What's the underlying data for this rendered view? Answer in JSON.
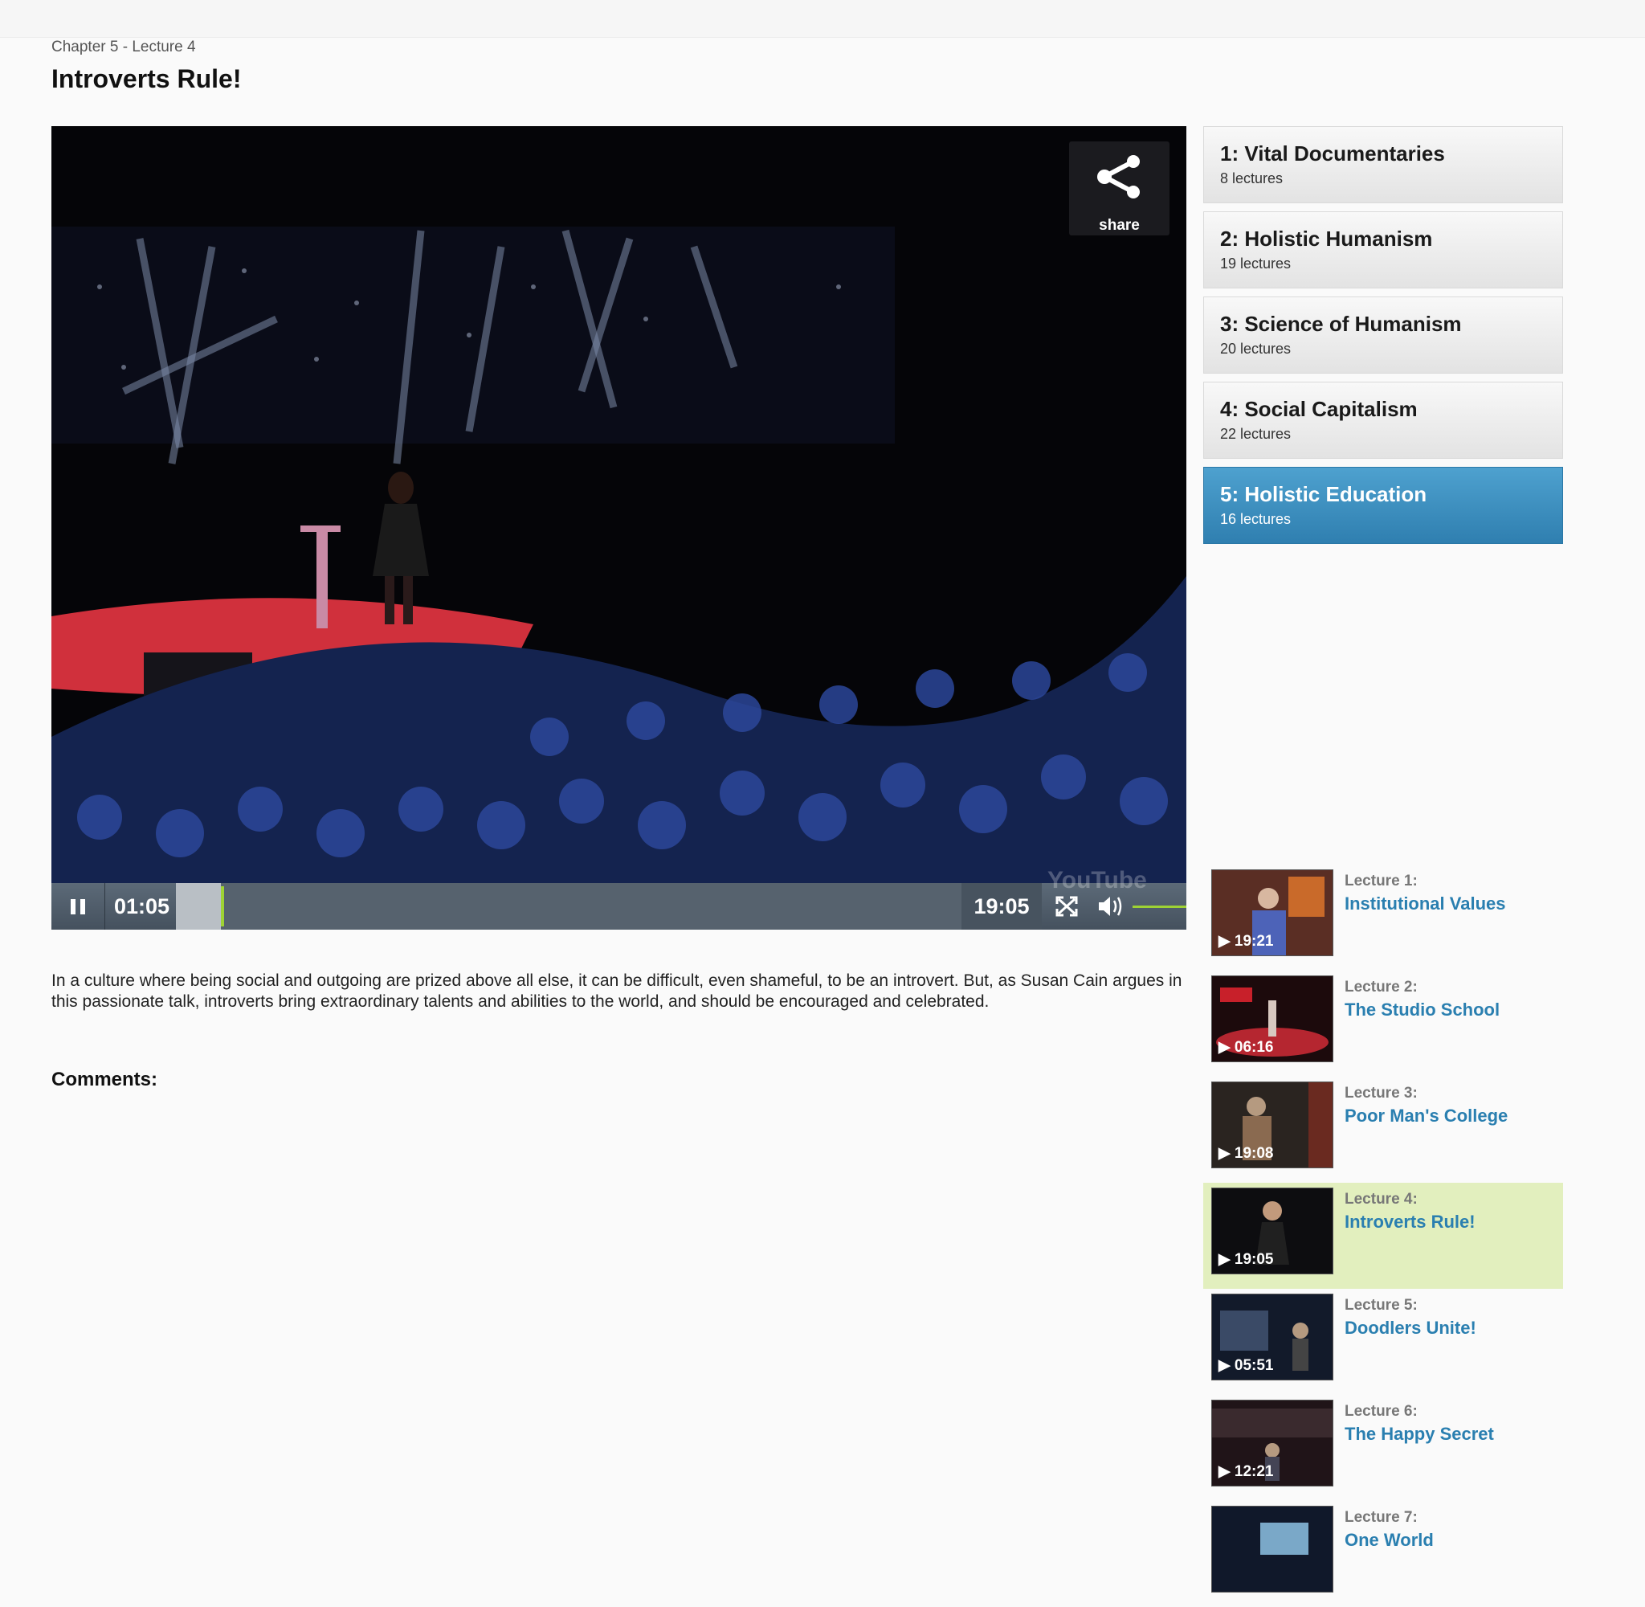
{
  "header": {
    "breadcrumb": "Chapter 5 - Lecture 4",
    "title": "Introverts Rule!"
  },
  "player": {
    "share_label": "share",
    "current_time": "01:05",
    "duration": "19:05",
    "progress_fraction": 0.057,
    "volume_fraction": 0.95,
    "is_playing": true,
    "watermark": "YouTube",
    "colors": {
      "controls": "#4f5c69",
      "progress": "#9ed234"
    }
  },
  "description": "In a culture where being social and outgoing are prized above all else, it can be difficult, even shameful, to be an introvert. But, as Susan Cain argues in this passionate talk, introverts bring extraordinary talents and abilities to the world, and should be encouraged and celebrated.",
  "comments_label": "Comments:",
  "chapters": [
    {
      "title": "1: Vital Documentaries",
      "count": "8 lectures"
    },
    {
      "title": "2: Holistic Humanism",
      "count": "19 lectures"
    },
    {
      "title": "3: Science of Humanism",
      "count": "20 lectures"
    },
    {
      "title": "4: Social Capitalism",
      "count": "22 lectures"
    },
    {
      "title": "5: Holistic Education",
      "count": "16 lectures",
      "active": true
    }
  ],
  "lectures": [
    {
      "number": "Lecture 1:",
      "title": "Institutional Values",
      "duration": "19:21"
    },
    {
      "number": "Lecture 2:",
      "title": "The Studio School",
      "duration": "06:16"
    },
    {
      "number": "Lecture 3:",
      "title": "Poor Man's College",
      "duration": "19:08"
    },
    {
      "number": "Lecture 4:",
      "title": "Introverts Rule!",
      "duration": "19:05",
      "current": true
    },
    {
      "number": "Lecture 5:",
      "title": "Doodlers Unite!",
      "duration": "05:51"
    },
    {
      "number": "Lecture 6:",
      "title": "The Happy Secret",
      "duration": "12:21"
    },
    {
      "number": "Lecture 7:",
      "title": "One World",
      "duration": ""
    }
  ],
  "colors": {
    "active_chapter": "#3a8dc0",
    "current_lecture": "#e2efbe",
    "link": "#2a7fb0"
  }
}
